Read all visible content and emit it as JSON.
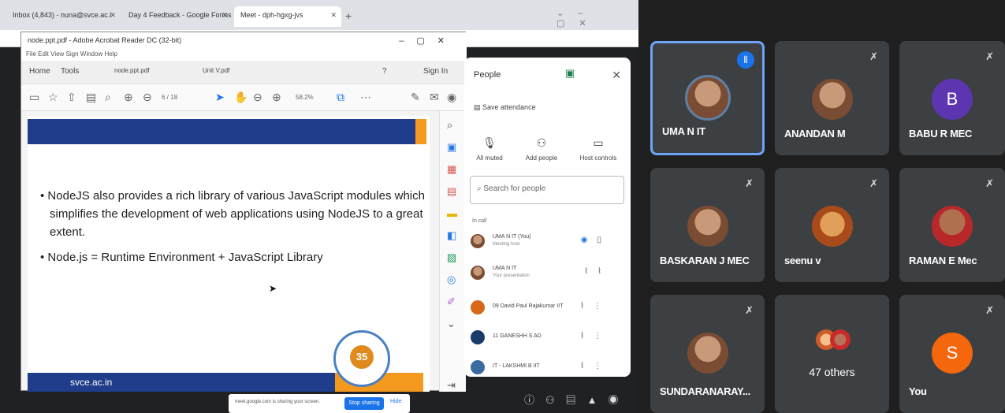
{
  "browser": {
    "tabs": [
      {
        "label": "Inbox (4,843) - nuna@svce.ac.i"
      },
      {
        "label": "Day 4 Feedback - Google Forms"
      },
      {
        "label": "Meet - dph-hgxg-jvs"
      }
    ]
  },
  "acrobat": {
    "title": "node.ppt.pdf - Adobe Acrobat Reader DC (32-bit)",
    "menu": "File  Edit  View  Sign  Window  Help",
    "tabs": {
      "home": "Home",
      "tools": "Tools",
      "doc1": "node.ppt.pdf",
      "doc2": "Unit V.pdf",
      "sign_in": "Sign In"
    },
    "page_box": "6 / 18",
    "zoom": "58.2%",
    "slide": {
      "bullet1": "NodeJS also provides a rich library of various JavaScript modules which simplifies the development of web applications using NodeJS to a great extent.",
      "bullet2": "Node.js = Runtime Environment + JavaScript Library",
      "footer": "svce.ac.in",
      "seal_text": "35"
    }
  },
  "people_panel": {
    "title": "People",
    "save_attendance": "Save attendance",
    "actions": {
      "all_muted": "All muted",
      "add_people": "Add people",
      "host_controls": "Host controls"
    },
    "search_placeholder": "Search for people",
    "section": "In call",
    "rows": [
      {
        "name": "UMA N IT (You)",
        "sub": "Meeting host"
      },
      {
        "name": "UMA N IT",
        "sub": "Your presentation"
      },
      {
        "name": "09 David Paul Rajakumar IIT",
        "sub": ""
      },
      {
        "name": "11 GANESHH S AD",
        "sub": ""
      },
      {
        "name": "IT - LAKSHMI B IIT",
        "sub": ""
      }
    ]
  },
  "share_notice": {
    "text": "meet.google.com is sharing your screen.",
    "stop_label": "Stop sharing",
    "hide_label": "Hide"
  },
  "tiles": [
    {
      "name": "UMA N IT",
      "avatar": "photo",
      "speaking": true
    },
    {
      "name": "ANANDAN M",
      "avatar": "photo"
    },
    {
      "name": "BABU R MEC",
      "avatar": "B",
      "color": "#5e35b1"
    },
    {
      "name": "BASKARAN J MEC",
      "avatar": "photo"
    },
    {
      "name": "seenu v",
      "avatar": "photo"
    },
    {
      "name": "RAMAN E Mec",
      "avatar": "photo"
    },
    {
      "name": "SUNDARANARAY...",
      "avatar": "photo"
    },
    {
      "name": "47 others",
      "avatar": "group"
    },
    {
      "name": "You",
      "avatar": "S",
      "color": "#f4670c"
    }
  ],
  "colors": {
    "accent": "#1a73e8",
    "tile_bg": "#3c4043",
    "active_border": "#6ea4f7"
  }
}
